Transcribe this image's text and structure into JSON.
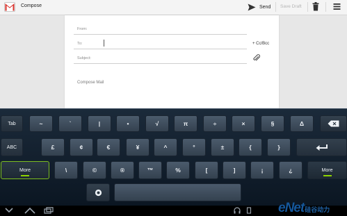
{
  "action_bar": {
    "title": "Compose",
    "send_label": "Send",
    "save_draft_label": "Save Draft"
  },
  "compose": {
    "from_label": "From:",
    "to_label": "To:",
    "subject_label": "Subject:",
    "cc_bcc_label": "+ Cc/Bcc",
    "body_placeholder": "Compose Mail"
  },
  "keyboard": {
    "row1": [
      "Tab",
      "~",
      "`",
      "|",
      "•",
      "√",
      "π",
      "÷",
      "×",
      "§",
      "Δ"
    ],
    "row2": [
      "ABC",
      "£",
      "¢",
      "€",
      "¥",
      "^",
      "°",
      "±",
      "{",
      "}"
    ],
    "row3": [
      "More",
      "\\",
      "©",
      "®",
      "™",
      "%",
      "[",
      "]",
      "¡",
      "¿",
      "More"
    ]
  },
  "watermark": {
    "brand": "eNet",
    "subtitle": "硅谷动力"
  },
  "colors": {
    "more_indicator": "#8fd400",
    "gmail_red": "#d9302a",
    "keyboard_bg": "#1b2a3a"
  }
}
